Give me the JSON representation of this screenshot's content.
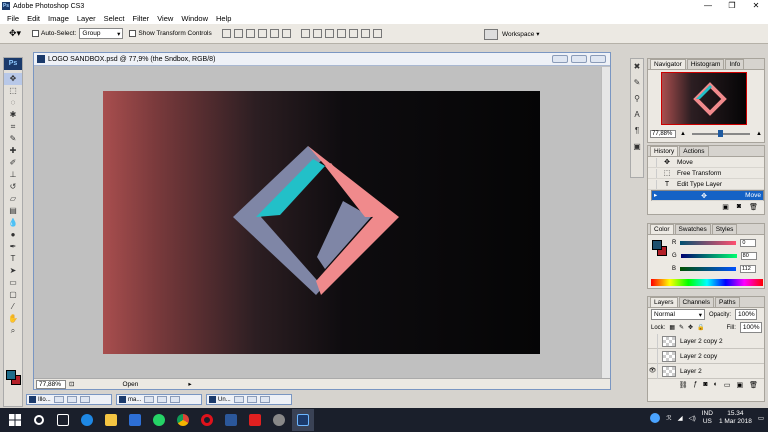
{
  "app": {
    "title": "Adobe Photoshop CS3",
    "window_controls": [
      "—",
      "❐",
      "✕"
    ]
  },
  "menu": [
    "File",
    "Edit",
    "Image",
    "Layer",
    "Select",
    "Filter",
    "View",
    "Window",
    "Help"
  ],
  "options_bar": {
    "auto_select_label": "Auto-Select:",
    "auto_select_value": "Group",
    "show_transform_label": "Show Transform Controls",
    "workspace_label": "Workspace ▾"
  },
  "document": {
    "title": "LOGO SANDBOX.psd @ 77,9% (the Sndbox, RGB/8)",
    "zoom": "77,88%",
    "status": "Open"
  },
  "minimized_docs": [
    "Illo...",
    "ma...",
    "Un..."
  ],
  "panels": {
    "navigator": {
      "tabs": [
        "Navigator",
        "Histogram",
        "Info"
      ],
      "zoom": "77,88%"
    },
    "history": {
      "tabs": [
        "History",
        "Actions"
      ],
      "items": [
        "Move",
        "Free Transform",
        "Edit Type Layer",
        "Move"
      ]
    },
    "color": {
      "tabs": [
        "Color",
        "Swatches",
        "Styles"
      ],
      "r_label": "R",
      "r_value": "0",
      "g_label": "G",
      "g_value": "80",
      "b_label": "B",
      "b_value": "112"
    },
    "layers": {
      "tabs": [
        "Layers",
        "Channels",
        "Paths"
      ],
      "blend_mode": "Normal",
      "opacity_label": "Opacity:",
      "opacity_value": "100%",
      "lock_label": "Lock:",
      "fill_label": "Fill:",
      "fill_value": "100%",
      "items": [
        "Layer 2 copy 2",
        "Layer 2 copy",
        "Layer 2"
      ]
    }
  },
  "taskbar": {
    "lang_top": "IND",
    "lang_bottom": "US",
    "time": "15.34",
    "date": "1 Mar 2018"
  },
  "colors": {
    "fg_swatch": "#1e506e",
    "bg_swatch": "#b32028",
    "logo_pink": "#f08a8c",
    "logo_slate": "#7f86a6",
    "logo_teal": "#22c0c8"
  }
}
